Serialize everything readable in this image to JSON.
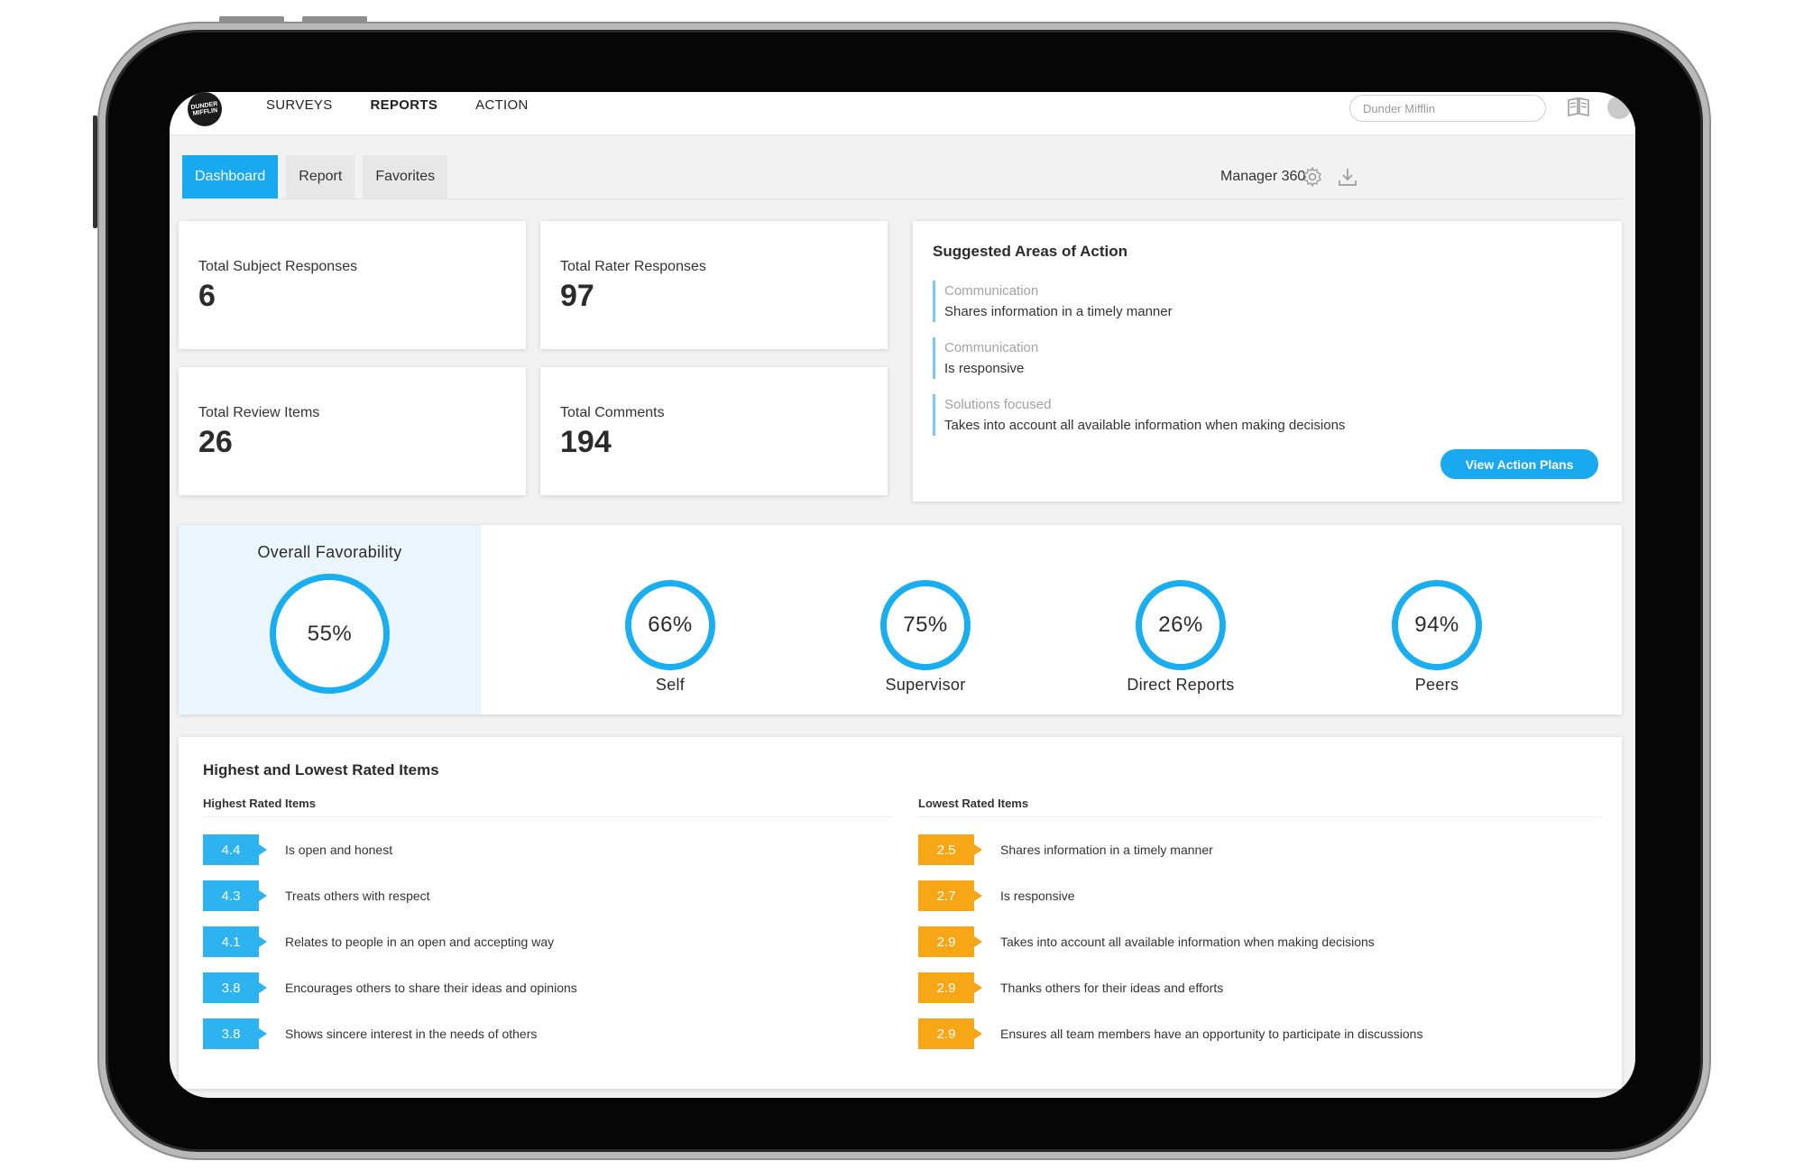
{
  "brand": {
    "logo_text": "DUNDER MIFFLIN",
    "accent": "#18a9ef",
    "low_color": "#f7a716"
  },
  "nav": {
    "items": [
      "SURVEYS",
      "REPORTS",
      "ACTION"
    ],
    "active": "REPORTS"
  },
  "company_field": {
    "placeholder": "Dunder Mifflin"
  },
  "tabs": [
    "Dashboard",
    "Report",
    "Favorites"
  ],
  "active_tab": "Dashboard",
  "survey_name": "Manager 360",
  "stats": [
    {
      "label": "Total Subject Responses",
      "value": "6"
    },
    {
      "label": "Total Rater Responses",
      "value": "97"
    },
    {
      "label": "Total Review Items",
      "value": "26"
    },
    {
      "label": "Total Comments",
      "value": "194"
    }
  ],
  "suggested": {
    "title": "Suggested Areas of Action",
    "items": [
      {
        "category": "Communication",
        "text": "Shares information in a timely manner"
      },
      {
        "category": "Communication",
        "text": "Is responsive"
      },
      {
        "category": "Solutions focused",
        "text": "Takes into account all available information when making decisions"
      }
    ],
    "button": "View Action Plans"
  },
  "favorability": {
    "title": "Overall Favorability",
    "overall": "55%",
    "groups": [
      {
        "label": "Self",
        "value": "66%"
      },
      {
        "label": "Supervisor",
        "value": "75%"
      },
      {
        "label": "Direct Reports",
        "value": "26%"
      },
      {
        "label": "Peers",
        "value": "94%"
      }
    ]
  },
  "rated": {
    "title": "Highest and Lowest Rated Items",
    "highest_label": "Highest Rated Items",
    "lowest_label": "Lowest Rated Items",
    "highest": [
      {
        "score": "4.4",
        "text": "Is open and honest"
      },
      {
        "score": "4.3",
        "text": "Treats others with respect"
      },
      {
        "score": "4.1",
        "text": "Relates to people in an open and accepting way"
      },
      {
        "score": "3.8",
        "text": "Encourages others to share their ideas and opinions"
      },
      {
        "score": "3.8",
        "text": "Shows sincere interest in the needs of others"
      }
    ],
    "lowest": [
      {
        "score": "2.5",
        "text": "Shares information in a timely manner"
      },
      {
        "score": "2.7",
        "text": "Is responsive"
      },
      {
        "score": "2.9",
        "text": "Takes into account all available information when making decisions"
      },
      {
        "score": "2.9",
        "text": "Thanks others for their ideas and efforts"
      },
      {
        "score": "2.9",
        "text": "Ensures all team members have an opportunity to participate in discussions"
      }
    ]
  }
}
